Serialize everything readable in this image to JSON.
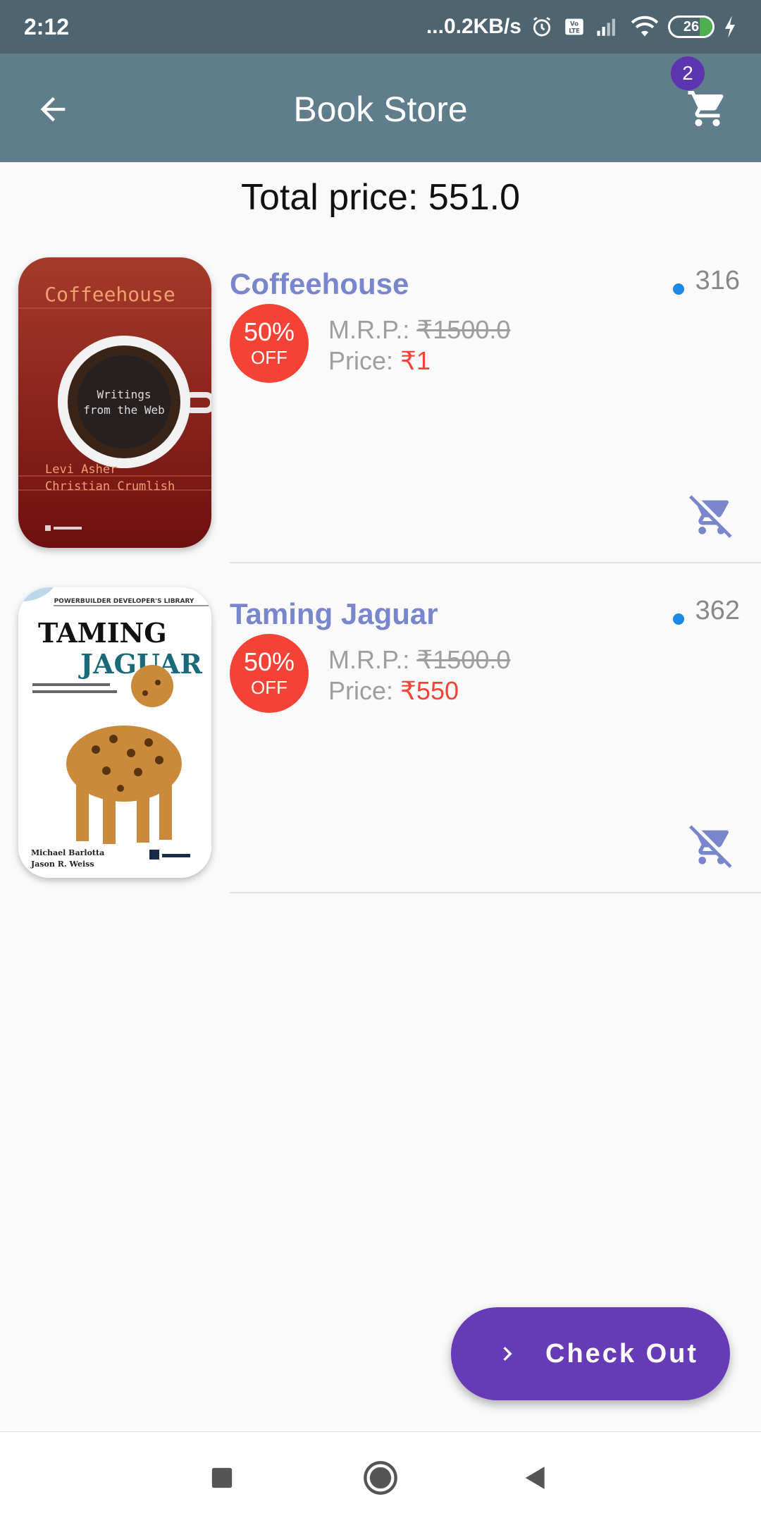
{
  "status_bar": {
    "time": "2:12",
    "network_speed": "...0.2KB/s",
    "battery_level": "26",
    "icons": [
      "alarm-icon",
      "volte-icon",
      "signal-icon",
      "wifi-icon",
      "battery-icon",
      "charging-icon"
    ]
  },
  "app_bar": {
    "title": "Book Store",
    "cart_count": "2",
    "back_icon": "arrow-back-icon",
    "cart_icon": "shopping-cart-icon"
  },
  "summary": {
    "total_price": "Total price: 551.0"
  },
  "cart_items": [
    {
      "title": "Coffeehouse",
      "count": "316",
      "discount_percent": "50%",
      "discount_off": "OFF",
      "mrp_label": "M.R.P.: ",
      "mrp_value": "₹1500.0",
      "price_label": "Price: ",
      "price_value": "₹1",
      "cover": {
        "title": "Coffeehouse",
        "subtitle": "Writings from the Web",
        "authors": "Levi Asher\nChristian Crumlish"
      }
    },
    {
      "title": "Taming Jaguar",
      "count": "362",
      "discount_percent": "50%",
      "discount_off": "OFF",
      "mrp_label": "M.R.P.: ",
      "mrp_value": "₹1500.0",
      "price_label": "Price: ",
      "price_value": "₹550",
      "cover": {
        "series": "POWERBUILDER DEVELOPER'S LIBRARY",
        "title_line1": "TAMING",
        "title_line2": "JAGUAR",
        "authors": "Michael Barlotta\nJason R. Weiss"
      }
    }
  ],
  "checkout": {
    "label": "Check Out",
    "icon": "chevron-right-icon"
  },
  "colors": {
    "status_bar": "#4e6470",
    "app_bar": "#607d8b",
    "title_accent": "#7986cb",
    "discount_red": "#f44336",
    "checkout_purple": "#673ab7",
    "badge_purple": "#5e35b1",
    "dot_blue": "#1e88e5"
  }
}
